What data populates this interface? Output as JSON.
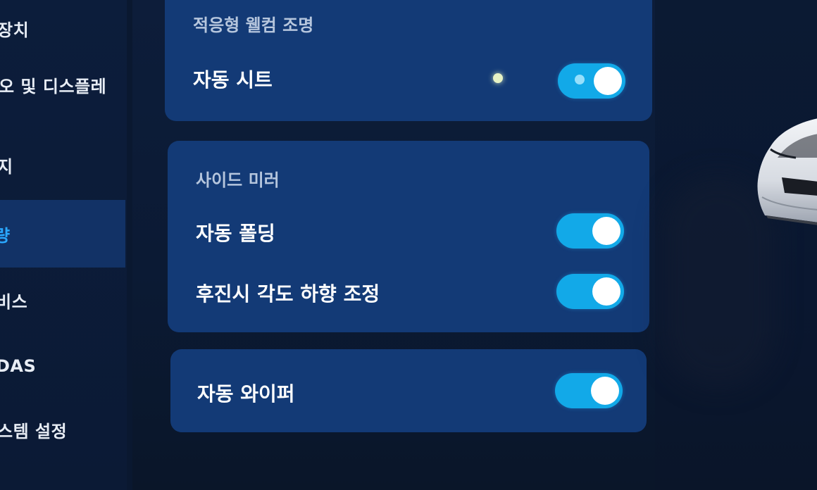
{
  "sidebar": {
    "items": [
      {
        "label": "장치"
      },
      {
        "label": "오 및 디스플레"
      },
      {
        "label": "지"
      },
      {
        "label": "량"
      },
      {
        "label": "비스"
      },
      {
        "label": "DAS"
      },
      {
        "label": "스템 설정"
      }
    ]
  },
  "lighting_card": {
    "title": "적응형 웰컴 조명",
    "rows": [
      {
        "label": "자동 시트",
        "enabled": true
      }
    ]
  },
  "mirror_card": {
    "title": "사이드 미러",
    "rows": [
      {
        "label": "자동 폴딩",
        "enabled": true
      },
      {
        "label": "후진시 각도 하향 조정",
        "enabled": true
      }
    ]
  },
  "wiper_card": {
    "rows": [
      {
        "label": "자동 와이퍼",
        "enabled": true
      }
    ]
  },
  "colors": {
    "card_background": "#133a76",
    "toggle_on": "#12a9e8",
    "active_sidebar_text": "#2aa8ff"
  },
  "icons": {
    "vehicle": "car-front-image"
  }
}
